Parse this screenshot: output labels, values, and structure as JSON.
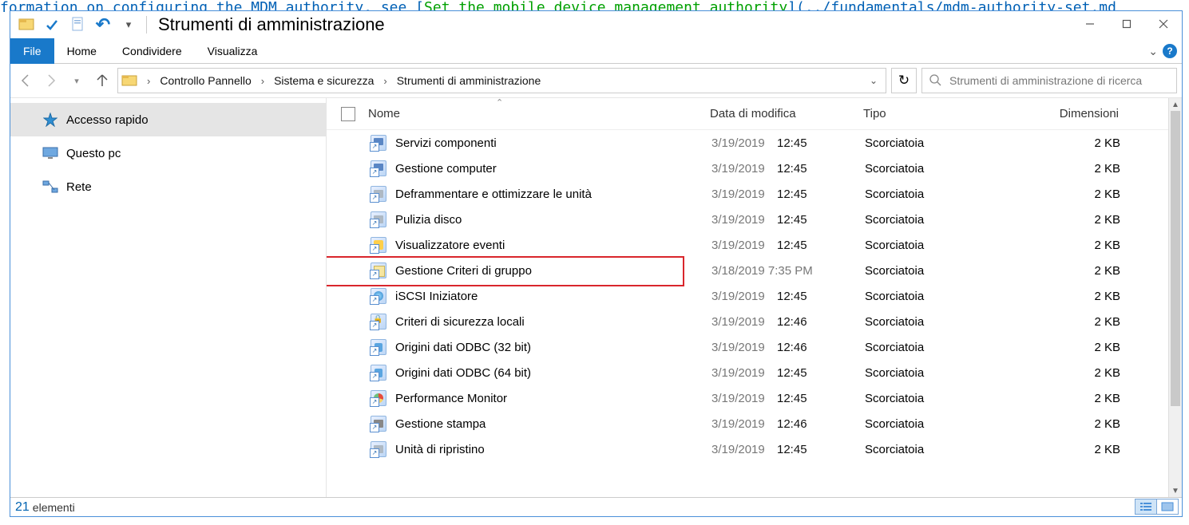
{
  "background_code_hint": {
    "text_before": "formation on configuring the MDM authority, see [",
    "link_text": "Set the mobile device management authority",
    "text_after": "](../fundamentals/mdm-authority-set.md"
  },
  "window": {
    "title": "Strumenti di amministrazione"
  },
  "ribbon": {
    "file": "File",
    "home": "Home",
    "share": "Condividere",
    "view": "Visualizza"
  },
  "breadcrumb": {
    "parts": [
      "Controllo Pannello",
      "Sistema e sicurezza",
      "Strumenti di amministrazione"
    ]
  },
  "refresh_glyph": "↻",
  "search": {
    "placeholder": "Strumenti di amministrazione di ricerca"
  },
  "sidebar": {
    "items": [
      {
        "label": "Accesso rapido",
        "icon": "star",
        "selected": true
      },
      {
        "label": "Questo pc",
        "icon": "monitor",
        "selected": false
      },
      {
        "label": "Rete",
        "icon": "network",
        "selected": false
      }
    ]
  },
  "columns": {
    "name": "Nome",
    "date": "Data di modifica",
    "type": "Tipo",
    "size": "Dimensioni"
  },
  "rows": [
    {
      "name": "Servizi componenti",
      "date": "3/19/2019",
      "time": "12:45",
      "type": "Scorciatoia",
      "size": "2 KB",
      "icon": "comp",
      "highlight": false
    },
    {
      "name": "Gestione computer",
      "date": "3/19/2019",
      "time": "12:45",
      "type": "Scorciatoia",
      "size": "2 KB",
      "icon": "comp",
      "highlight": false
    },
    {
      "name": "Deframmentare e ottimizzare le unità",
      "date": "3/19/2019",
      "time": "12:45",
      "type": "Scorciatoia",
      "size": "2 KB",
      "icon": "disk",
      "highlight": false
    },
    {
      "name": "Pulizia disco",
      "date": "3/19/2019",
      "time": "12:45",
      "type": "Scorciatoia",
      "size": "2 KB",
      "icon": "disk",
      "highlight": false
    },
    {
      "name": "Visualizzatore eventi",
      "date": "3/19/2019",
      "time": "12:45",
      "type": "Scorciatoia",
      "size": "2 KB",
      "icon": "ev",
      "highlight": false
    },
    {
      "name": "Gestione Criteri di gruppo",
      "date": "3/18/2019 7:35 PM",
      "time": "",
      "type": "Scorciatoia",
      "size": "2 KB",
      "icon": "gp",
      "highlight": true
    },
    {
      "name": "iSCSI Iniziatore",
      "date": "3/19/2019",
      "time": "12:45",
      "type": "Scorciatoia",
      "size": "2 KB",
      "icon": "net",
      "highlight": false
    },
    {
      "name": "Criteri di sicurezza locali",
      "date": "3/19/2019",
      "time": "12:46",
      "type": "Scorciatoia",
      "size": "2 KB",
      "icon": "lock",
      "highlight": false
    },
    {
      "name": "Origini dati ODBC (32 bit)",
      "date": "3/19/2019",
      "time": "12:46",
      "type": "Scorciatoia",
      "size": "2 KB",
      "icon": "db",
      "highlight": false
    },
    {
      "name": "Origini dati ODBC (64 bit)",
      "date": "3/19/2019",
      "time": "12:45",
      "type": "Scorciatoia",
      "size": "2 KB",
      "icon": "db",
      "highlight": false
    },
    {
      "name": "Performance Monitor",
      "date": "3/19/2019",
      "time": "12:45",
      "type": "Scorciatoia",
      "size": "2 KB",
      "icon": "perf",
      "highlight": false
    },
    {
      "name": "Gestione stampa",
      "date": "3/19/2019",
      "time": "12:46",
      "type": "Scorciatoia",
      "size": "2 KB",
      "icon": "print",
      "highlight": false
    },
    {
      "name": "Unità di ripristino",
      "date": "3/19/2019",
      "time": "12:45",
      "type": "Scorciatoia",
      "size": "2 KB",
      "icon": "disk",
      "highlight": false
    }
  ],
  "status": {
    "count": "21",
    "label": "elementi"
  }
}
